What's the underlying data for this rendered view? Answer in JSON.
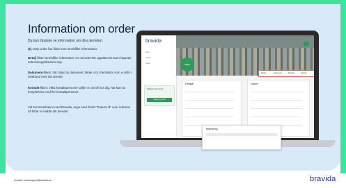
{
  "slide": {
    "title": "Information om order",
    "subtitle": "Du kan löpande se information om dina ärenden.",
    "paragraphs": [
      {
        "bold": "(1)",
        "text": " Varje order har flikar som innehåller information:"
      },
      {
        "bold": "Detalj",
        "text": "-fliken innehåller information om ärendet här uppdateras även löpande anteckningar/beskrivning."
      },
      {
        "bold": "Dokument",
        "text": "-fliken: här hittar du dokument, bilder och checklistor som vi utför i samband med ditt ärende."
      },
      {
        "bold": "Kontakt",
        "text": "-fliken: vilka kontaktpersoner väljer vi oss till hos dig, här kan du komplettera med fler kontaktpersoner."
      },
      {
        "bold": "",
        "text": "Vid kommunikation med Bravida, ange med fördel \"Externt id\" som referens så hittar vi snabbt ditt ärende!"
      }
    ],
    "footer_contact": "Kontakt: kundsupport@bravida.se",
    "footer_logo": "bravida",
    "colors": {
      "accent": "#3ee3a0",
      "panel": "#d8eaf8",
      "text": "#16284a",
      "brand": "#1e3a8a"
    }
  },
  "app": {
    "logo": "bravida",
    "side_items": [
      "Hem",
      "Order",
      "Avtal"
    ],
    "side_card": {
      "title": "Välkommen kund",
      "button": "Skapa ny order"
    },
    "hero_badge": "Pågår",
    "tabs": [
      "Detalj",
      "Dokument",
      "Kontakt",
      "Historik"
    ],
    "cards": [
      {
        "title": "Detaljer"
      },
      {
        "title": "Datum"
      }
    ],
    "popup": {
      "title": "Beskrivning"
    }
  }
}
